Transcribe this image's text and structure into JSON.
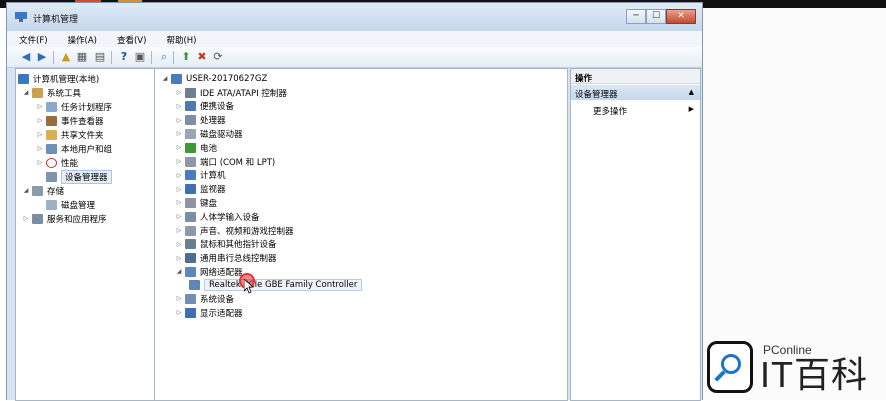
{
  "window": {
    "title": "计算机管理",
    "btn_min": "─",
    "btn_max": "☐",
    "btn_close": "✕"
  },
  "menu": [
    "文件(F)",
    "操作(A)",
    "查看(V)",
    "帮助(H)"
  ],
  "left_tree": {
    "root": "计算机管理(本地)",
    "system_tools": "系统工具",
    "system_children": [
      "任务计划程序",
      "事件查看器",
      "共享文件夹",
      "本地用户和组",
      "性能",
      "设备管理器"
    ],
    "storage": "存储",
    "storage_children": [
      "磁盘管理"
    ],
    "services": "服务和应用程序"
  },
  "device_tree": {
    "computer": "USER-20170627GZ",
    "categories": [
      "IDE ATA/ATAPI 控制器",
      "便携设备",
      "处理器",
      "磁盘驱动器",
      "电池",
      "端口 (COM 和 LPT)",
      "计算机",
      "监视器",
      "键盘",
      "人体学输入设备",
      "声音、视频和游戏控制器",
      "鼠标和其他指针设备",
      "通用串行总线控制器",
      "网络适配器"
    ],
    "network_child": "Realtek PCIe GBE Family Controller",
    "after": [
      "系统设备",
      "显示适配器"
    ]
  },
  "actions": {
    "header": "操作",
    "title": "设备管理器",
    "title_arrow": "▲",
    "more": "更多操作",
    "more_arrow": "▶"
  },
  "watermark": {
    "small": "PConline",
    "big": "IT百科"
  },
  "icons": {
    "toolbar": [
      "back-icon",
      "forward-icon",
      "up-folder-icon",
      "show-hide-tree-icon",
      "export-list-icon",
      "help-icon",
      "properties-icon",
      "scan-hardware-icon",
      "update-driver-icon",
      "disable-device-icon",
      "uninstall-device-icon"
    ]
  },
  "colors": {
    "window_frame": "#d6e3f1",
    "selection": "#e5eef9",
    "cursor_highlight": "#e12828",
    "watermark_blue": "#1e74c6"
  }
}
